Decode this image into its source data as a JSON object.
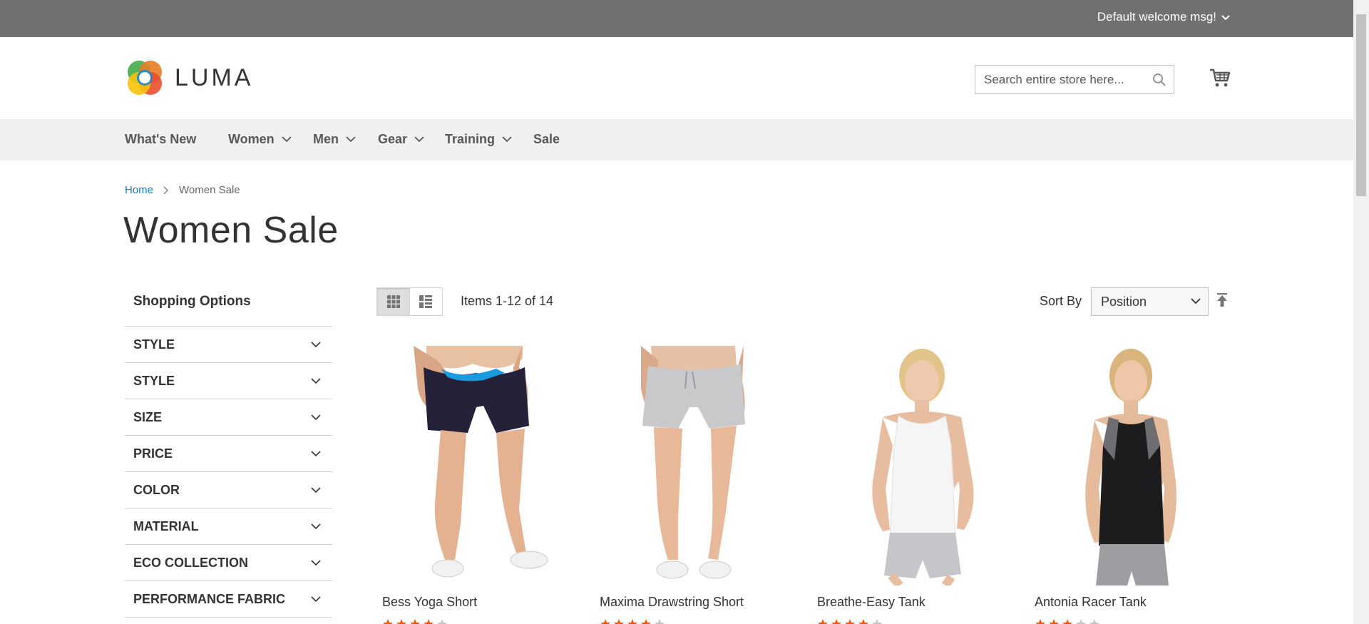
{
  "header": {
    "welcome": "Default welcome msg!",
    "logo_text": "LUMA",
    "search_placeholder": "Search entire store here..."
  },
  "nav": {
    "items": [
      {
        "label": "What's New",
        "dropdown": false
      },
      {
        "label": "Women",
        "dropdown": true
      },
      {
        "label": "Men",
        "dropdown": true
      },
      {
        "label": "Gear",
        "dropdown": true
      },
      {
        "label": "Training",
        "dropdown": true
      },
      {
        "label": "Sale",
        "dropdown": false
      }
    ]
  },
  "breadcrumb": {
    "home": "Home",
    "current": "Women Sale"
  },
  "page": {
    "title": "Women Sale"
  },
  "sidebar": {
    "title": "Shopping Options",
    "filters": [
      "STYLE",
      "STYLE",
      "SIZE",
      "PRICE",
      "COLOR",
      "MATERIAL",
      "ECO COLLECTION",
      "PERFORMANCE FABRIC"
    ]
  },
  "toolbar": {
    "amount": "Items 1-12 of 14",
    "sort_label": "Sort By",
    "sort_value": "Position"
  },
  "products": [
    {
      "name": "Bess Yoga Short",
      "rating": 4
    },
    {
      "name": "Maxima Drawstring Short",
      "rating": 4
    },
    {
      "name": "Breathe-Easy Tank",
      "rating": 4
    },
    {
      "name": "Antonia Racer Tank",
      "rating": 3
    }
  ],
  "colors": {
    "topbar": "#6e716e",
    "nav_bg": "#f0f0f0",
    "link": "#1979c3",
    "star": "#ff5501"
  }
}
